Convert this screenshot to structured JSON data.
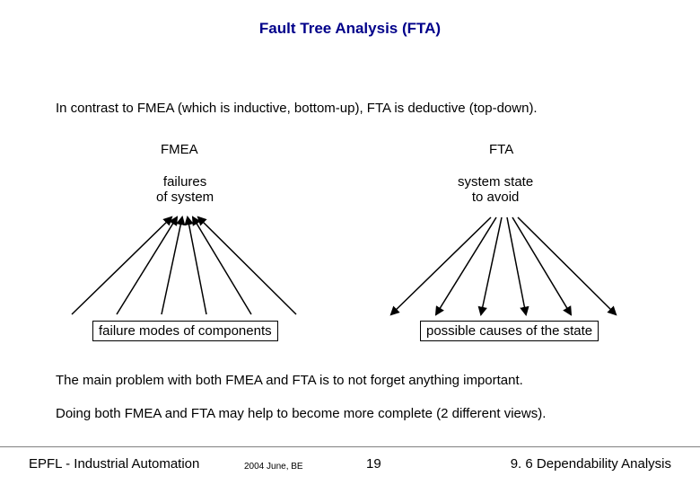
{
  "title": "Fault Tree Analysis (FTA)",
  "intro": "In contrast to FMEA (which is inductive, bottom-up), FTA is deductive (top-down).",
  "left": {
    "name": "FMEA",
    "top_label": "failures\nof system",
    "bottom_box": "failure modes of components"
  },
  "right": {
    "name": "FTA",
    "top_label": "system state\nto avoid",
    "bottom_box": "possible causes of the state"
  },
  "body1": "The main problem with both FMEA and FTA is to not forget anything important.",
  "body2": "Doing both FMEA and FTA may help to become more complete (2 different views).",
  "footer": {
    "left": "EPFL - Industrial Automation",
    "mid": "2004 June, BE",
    "page": "19",
    "right": "9. 6 Dependability Analysis"
  },
  "colors": {
    "title": "#00008a"
  }
}
